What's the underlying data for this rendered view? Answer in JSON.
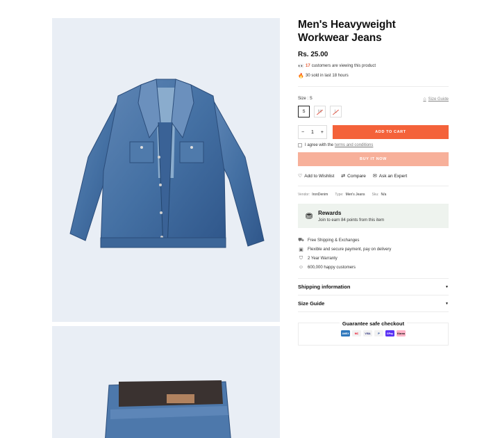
{
  "product": {
    "title": "Men's Heavyweight Workwear Jeans",
    "price": "Rs. 25.00",
    "viewers_count": "17",
    "viewers_text": "customers are viewing this product",
    "sold_text": "30 sold in last 18 hours"
  },
  "size": {
    "label": "Size : ",
    "selected": "S",
    "guide_label": "Size Guide",
    "options": [
      {
        "label": "S",
        "available": true
      },
      {
        "label": "M",
        "available": false
      },
      {
        "label": "L",
        "available": false
      }
    ]
  },
  "cart": {
    "quantity": "1",
    "minus": "−",
    "plus": "+",
    "add_label": "ADD TO CART",
    "agree_text": "I agree with the",
    "agree_link": "terms and conditions",
    "buy_now_label": "BUY IT NOW"
  },
  "actions": {
    "wishlist": "Add to Wishlist",
    "compare": "Compare",
    "expert": "Ask an Expert"
  },
  "meta": {
    "vendor_label": "Vendor:",
    "vendor_value": "IronDenim",
    "type_label": "Type:",
    "type_value": "Men's Jeans",
    "sku_label": "Sku:",
    "sku_value": "N/a"
  },
  "rewards": {
    "title": "Rewards",
    "subtitle": "Join to earn 84 points from this item"
  },
  "features": [
    "Free Shipping & Exchanges",
    "Flexible and secure payment, pay on delivery",
    "2 Year Warranty",
    "600,000 happy customers"
  ],
  "accordion": [
    "Shipping information",
    "Size Guide"
  ],
  "checkout": {
    "title": "Guarantee safe checkout",
    "methods": [
      {
        "name": "AMEX",
        "color": "#2e77bc"
      },
      {
        "name": "MC",
        "color": "#eb001b"
      },
      {
        "name": "VISA",
        "color": "#1a1f71"
      },
      {
        "name": "P",
        "color": "#003087"
      },
      {
        "name": "GPay",
        "color": "#5a31f4"
      },
      {
        "name": "Klarna",
        "color": "#ffb3c7"
      }
    ]
  },
  "colors": {
    "accent": "#f4623a",
    "buy_now": "#f7b09a",
    "gallery_bg": "#e9eef5",
    "rewards_bg": "#eef3ee"
  }
}
